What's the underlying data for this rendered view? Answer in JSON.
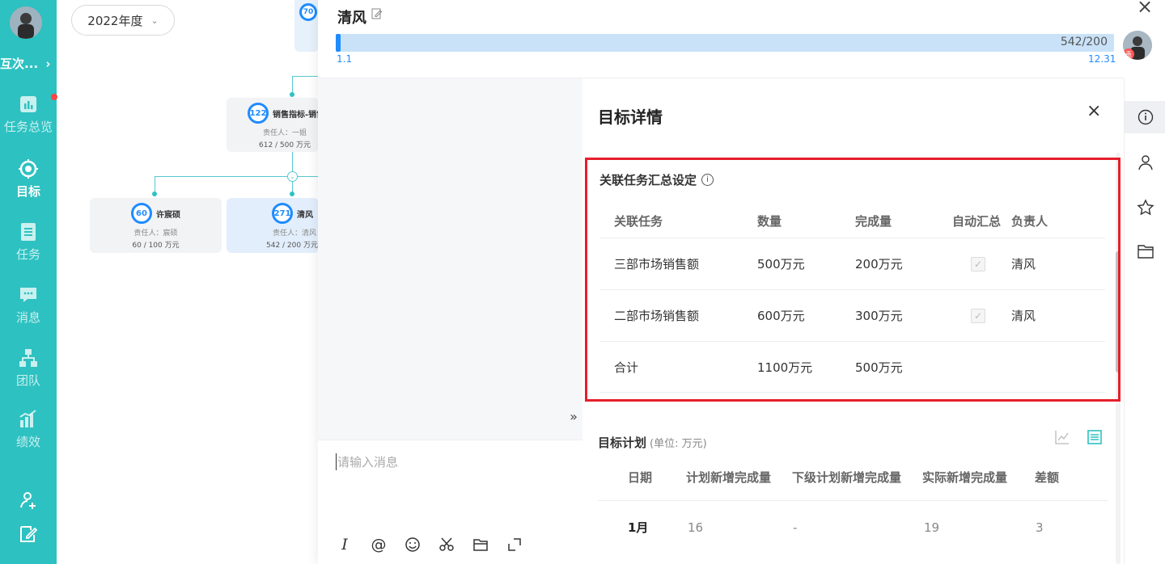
{
  "nav": {
    "org_name": "互次...",
    "org_chevron": "›",
    "items": [
      {
        "label": "任务总览",
        "icon": "bar-chart-icon"
      },
      {
        "label": "目标",
        "icon": "target-icon"
      },
      {
        "label": "任务",
        "icon": "task-list-icon"
      },
      {
        "label": "消息",
        "icon": "message-icon"
      },
      {
        "label": "团队",
        "icon": "team-icon"
      },
      {
        "label": "绩效",
        "icon": "performance-icon"
      }
    ]
  },
  "canvas": {
    "year": "2022年度",
    "top_node_count": "70",
    "nodes": [
      {
        "count": "122",
        "name": "销售指标-销售",
        "owner": "责任人：一姐",
        "progress": "612 / 500 万元"
      },
      {
        "count": "60",
        "name": "许宸硕",
        "owner": "责任人：宸硕",
        "progress": "60 / 100 万元"
      },
      {
        "count": "271",
        "name": "清风",
        "owner": "责任人：清风",
        "progress": "542 / 200 万元"
      }
    ]
  },
  "panel": {
    "title": "清风",
    "progress_value": "542/200",
    "progress_start": "1.1",
    "progress_end": "12.31",
    "avatar_tag": "责",
    "close": "×"
  },
  "chat": {
    "placeholder": "请输入消息",
    "expand": "»",
    "tools": [
      "italic-icon",
      "at-icon",
      "emoji-icon",
      "scissors-icon",
      "folder-icon",
      "fullscreen-icon"
    ],
    "italic_label": "I",
    "at_label": "@"
  },
  "detail": {
    "title": "目标详情",
    "close": "×",
    "linked": {
      "title": "关联任务汇总设定",
      "info": "i",
      "headers": [
        "关联任务",
        "数量",
        "完成量",
        "自动汇总",
        "负责人"
      ],
      "rows": [
        {
          "task": "三部市场销售额",
          "quantity": "500万元",
          "done": "200万元",
          "auto": true,
          "owner": "清风"
        },
        {
          "task": "二部市场销售额",
          "quantity": "600万元",
          "done": "300万元",
          "auto": true,
          "owner": "清风"
        },
        {
          "task": "合计",
          "quantity": "1100万元",
          "done": "500万元",
          "auto": false,
          "owner": ""
        }
      ]
    },
    "plan": {
      "title": "目标计划",
      "unit": "(单位: 万元)",
      "headers": [
        "日期",
        "计划新增完成量",
        "下级计划新增完成量",
        "实际新增完成量",
        "差额"
      ],
      "rows": [
        {
          "date": "1月",
          "plan": "16",
          "sub_plan": "-",
          "actual": "19",
          "diff": "3"
        }
      ]
    }
  },
  "rail": [
    "info-icon",
    "person-icon",
    "star-icon",
    "folder-icon"
  ],
  "colors": {
    "nav_bg": "#2ec1c1",
    "accent": "#1e8bff",
    "highlight_border": "#e61e2b"
  }
}
